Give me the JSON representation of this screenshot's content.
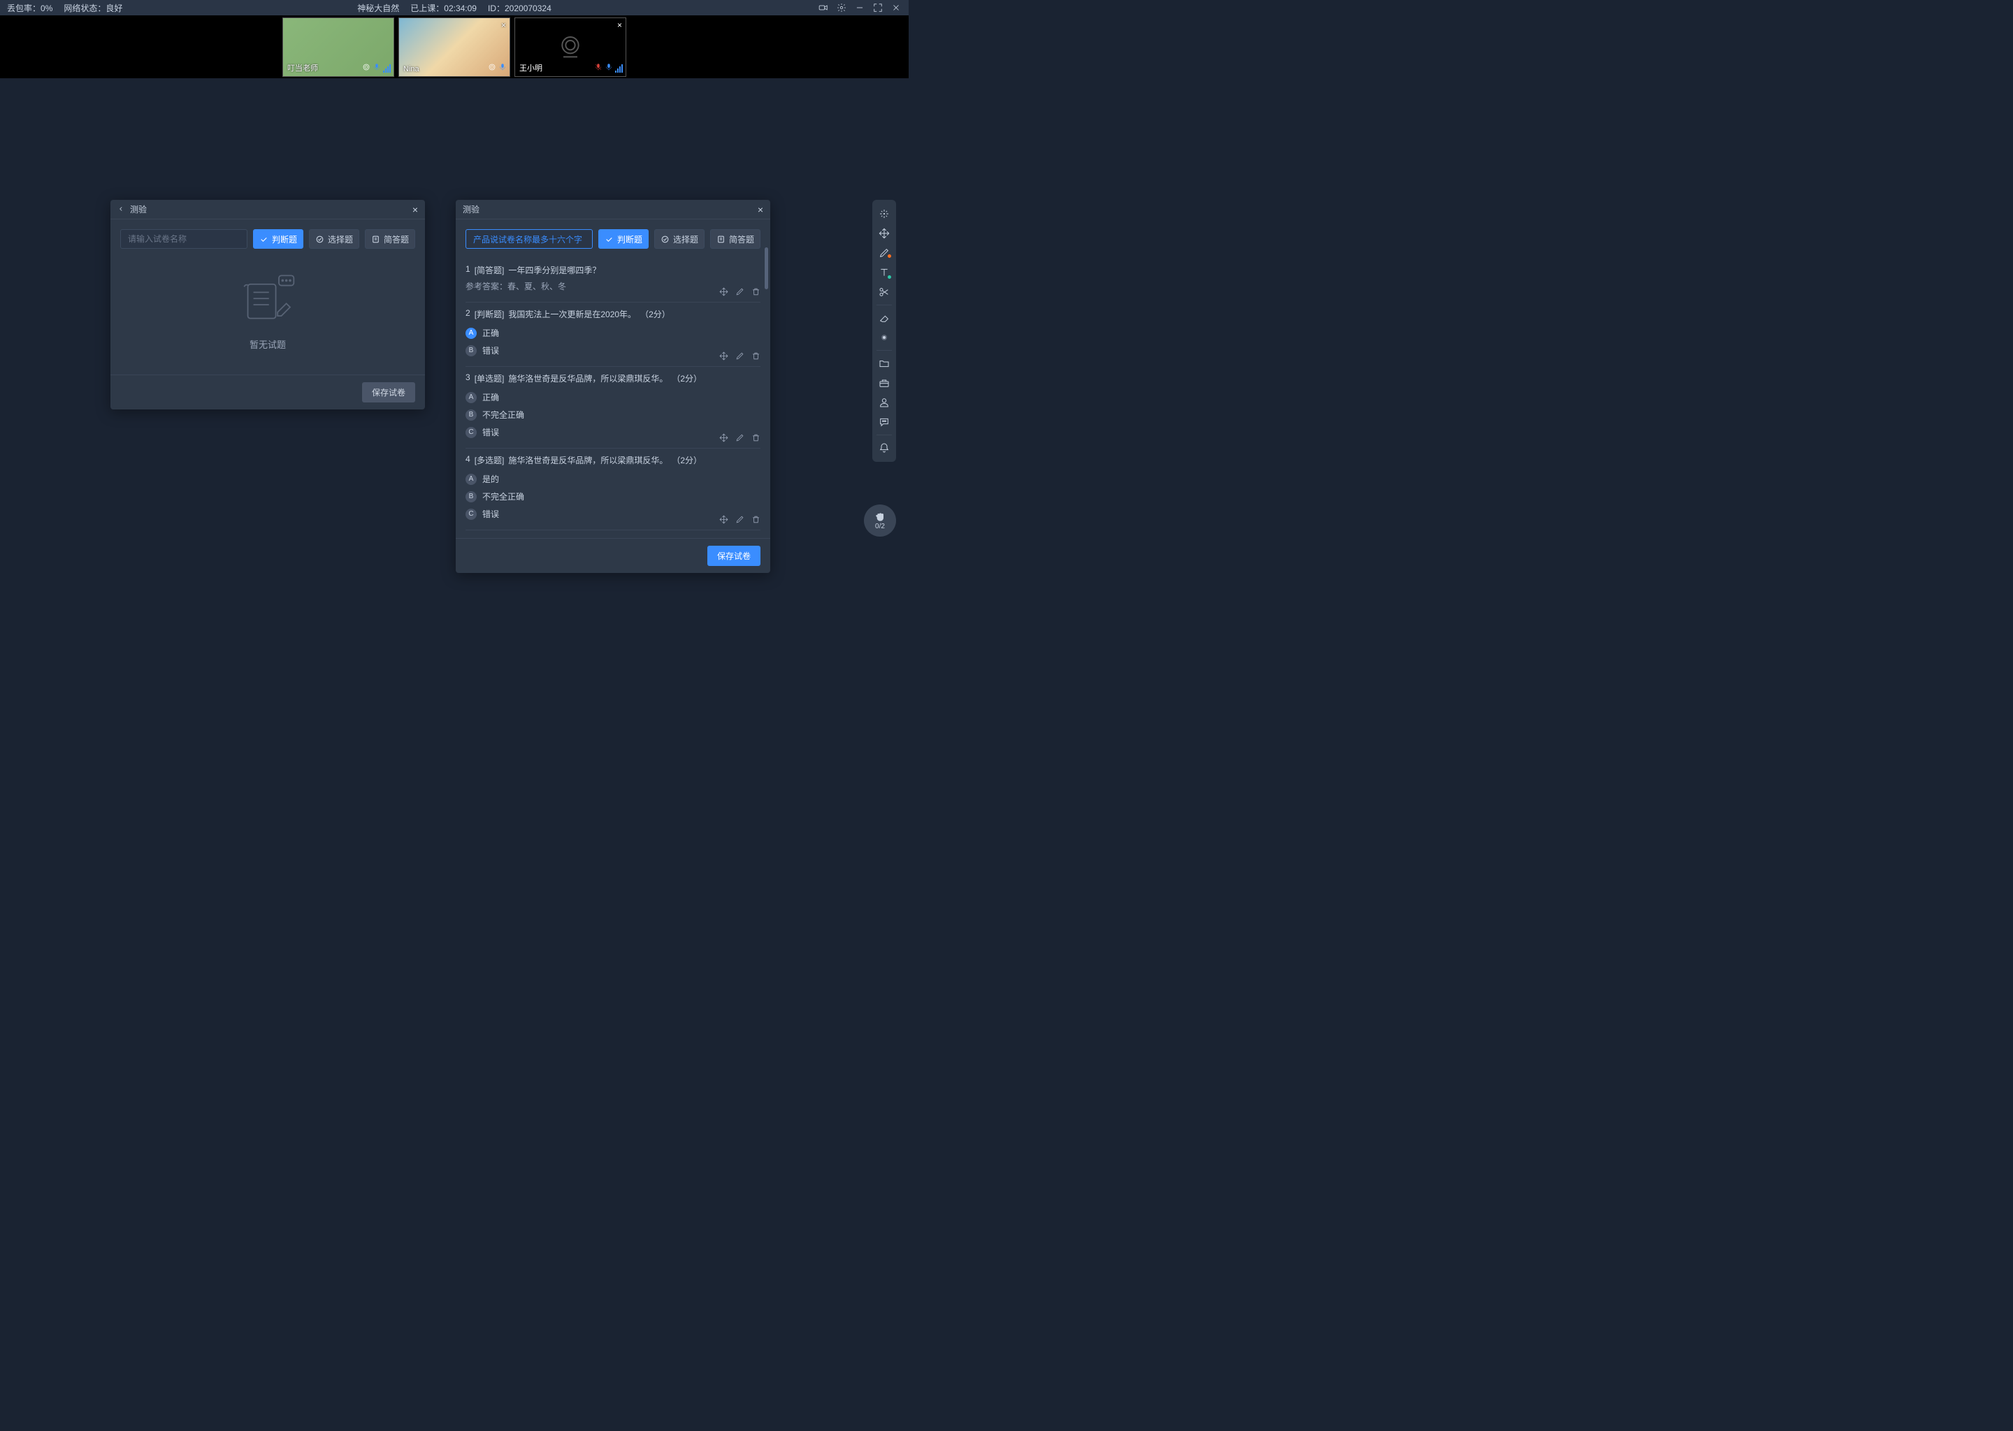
{
  "topbar": {
    "packet_loss_label": "丢包率：",
    "packet_loss": "0%",
    "network_label": "网络状态：",
    "network_status": "良好",
    "class_title": "神秘大自然",
    "elapsed_label": "已上课：",
    "elapsed": "02:34:09",
    "id_label": "ID：",
    "session_id": "2020070324"
  },
  "videos": [
    {
      "name": "叮当老师",
      "camera_on": true,
      "muted": false,
      "closable": false
    },
    {
      "name": "Nina",
      "camera_on": true,
      "muted": false,
      "closable": true
    },
    {
      "name": "王小明",
      "camera_on": false,
      "muted": true,
      "closable": true
    }
  ],
  "panelA": {
    "title": "测验",
    "name_placeholder": "请输入试卷名称",
    "btn_judge": "判断题",
    "btn_choice": "选择题",
    "btn_short": "简答题",
    "empty_text": "暂无试题",
    "save_btn": "保存试卷"
  },
  "panelB": {
    "title": "测验",
    "name_value": "产品说试卷名称最多十六个字",
    "btn_judge": "判断题",
    "btn_choice": "选择题",
    "btn_short": "简答题",
    "answer_label": "参考答案：",
    "save_btn": "保存试卷",
    "questions": [
      {
        "idx": "1",
        "tag": "[简答题]",
        "text": "一年四季分别是哪四季？",
        "answer": "春、夏、秋、冬",
        "options": []
      },
      {
        "idx": "2",
        "tag": "[判断题]",
        "text": "我国宪法上一次更新是在2020年。",
        "score": "（2分）",
        "options": [
          {
            "letter": "A",
            "text": "正确",
            "selected": true
          },
          {
            "letter": "B",
            "text": "错误"
          }
        ]
      },
      {
        "idx": "3",
        "tag": "[单选题]",
        "text": "施华洛世奇是反华品牌，所以梁鼎琪反华。",
        "score": "（2分）",
        "options": [
          {
            "letter": "A",
            "text": "正确"
          },
          {
            "letter": "B",
            "text": "不完全正确"
          },
          {
            "letter": "C",
            "text": "错误"
          }
        ]
      },
      {
        "idx": "4",
        "tag": "[多选题]",
        "text": "施华洛世奇是反华品牌，所以梁鼎琪反华。",
        "score": "（2分）",
        "options": [
          {
            "letter": "A",
            "text": "是的"
          },
          {
            "letter": "B",
            "text": "不完全正确"
          },
          {
            "letter": "C",
            "text": "错误"
          }
        ]
      }
    ]
  },
  "hand": {
    "count": "0/2"
  }
}
